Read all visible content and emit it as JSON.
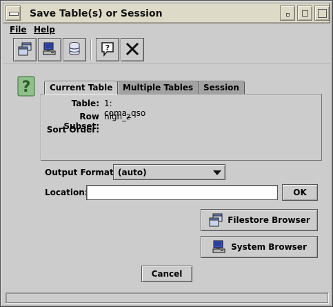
{
  "window": {
    "title": "Save Table(s) or Session"
  },
  "menubar": {
    "file": "File",
    "help": "Help"
  },
  "toolbar": {
    "icons": [
      "windows-icon",
      "computer-icon",
      "database-icon",
      "help-icon",
      "close-icon"
    ]
  },
  "tabs": [
    {
      "label": "Current Table",
      "active": true
    },
    {
      "label": "Multiple Tables",
      "active": false
    },
    {
      "label": "Session",
      "active": false
    }
  ],
  "current_table": {
    "table_label": "Table:",
    "table_value": "1: coma_qso",
    "row_subset_label": "Row Subset:",
    "row_subset_value": "high_z",
    "sort_order_label": "Sort Order:",
    "sort_order_value": ""
  },
  "output_format": {
    "label": "Output Format:",
    "value": "(auto)"
  },
  "location": {
    "label": "Location:",
    "value": "",
    "ok_label": "OK"
  },
  "buttons": {
    "filestore_browser": "Filestore Browser",
    "system_browser": "System Browser",
    "cancel": "Cancel"
  },
  "colors": {
    "title_bar": "#dedac8",
    "window_bg": "#cccccc",
    "inactive_tab": "#a3a3a3"
  }
}
